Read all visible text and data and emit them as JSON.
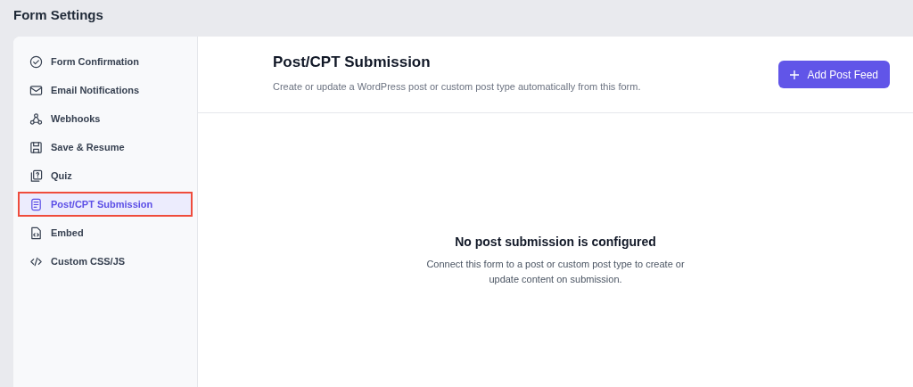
{
  "page_title": "Form Settings",
  "sidebar": {
    "items": [
      {
        "label": "Form Confirmation",
        "selected": false
      },
      {
        "label": "Email Notifications",
        "selected": false
      },
      {
        "label": "Webhooks",
        "selected": false
      },
      {
        "label": "Save & Resume",
        "selected": false
      },
      {
        "label": "Quiz",
        "selected": false
      },
      {
        "label": "Post/CPT Submission",
        "selected": true
      },
      {
        "label": "Embed",
        "selected": false
      },
      {
        "label": "Custom CSS/JS",
        "selected": false
      }
    ]
  },
  "header": {
    "title": "Post/CPT Submission",
    "subtitle": "Create or update a WordPress post or custom post type automatically from this form.",
    "button": "Add Post Feed"
  },
  "empty_state": {
    "title": "No post submission is configured",
    "message": "Connect this form to a post or custom post type to create or update content on submission."
  }
}
